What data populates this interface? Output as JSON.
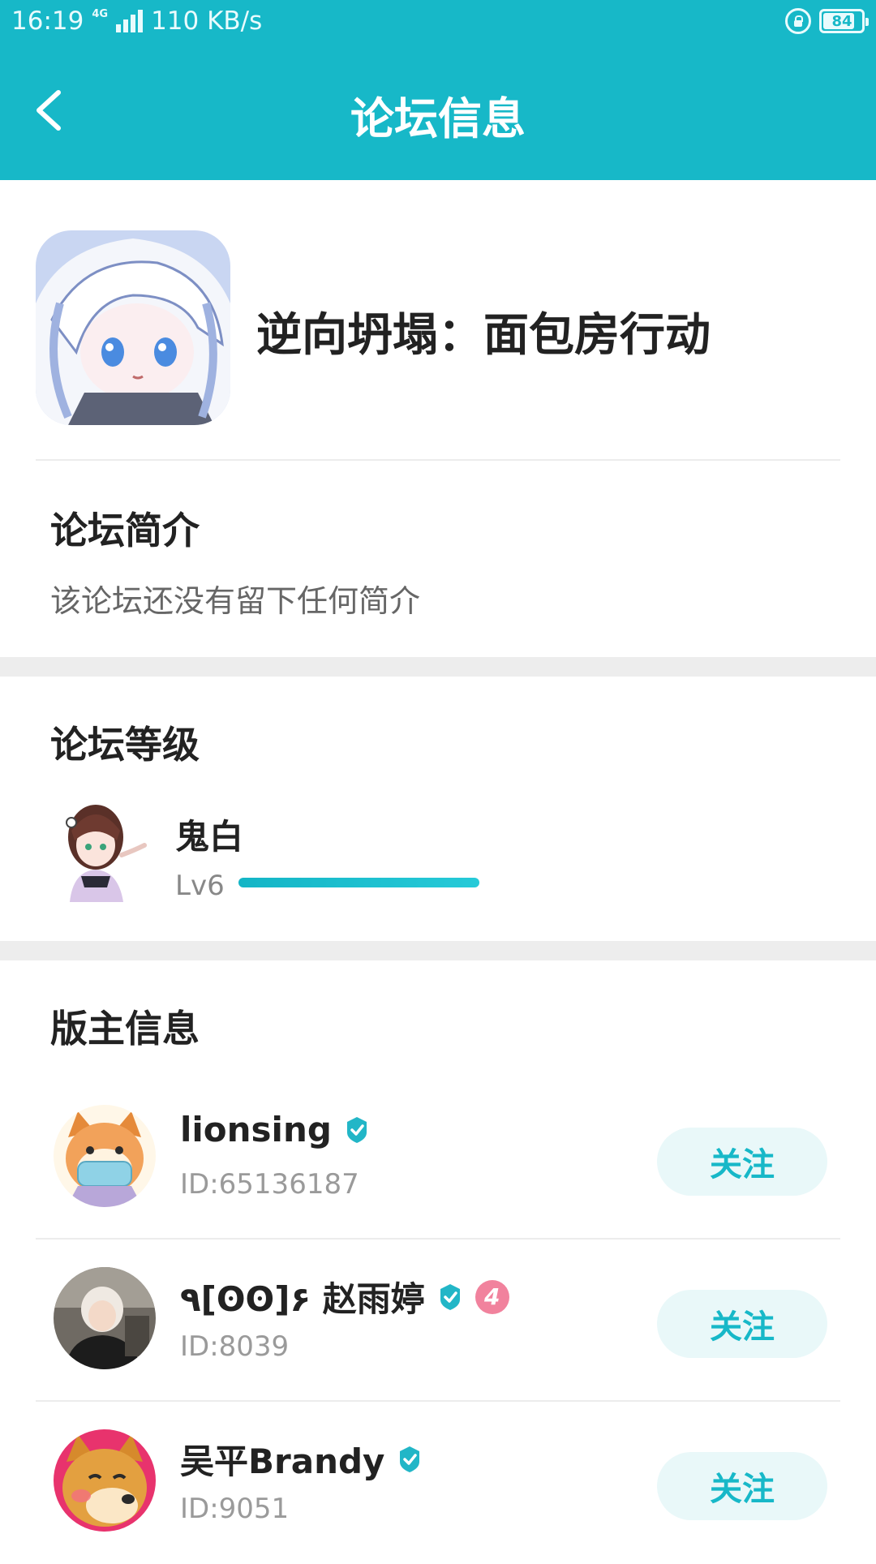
{
  "status_bar": {
    "time": "16:19",
    "network_type": "4G",
    "speed": "110 KB/s",
    "battery": "84",
    "battery_level": 0.84
  },
  "app_bar": {
    "title": "论坛信息",
    "back_icon": "chevron-left-icon"
  },
  "forum": {
    "name": "逆向坍塌：面包房行动"
  },
  "intro": {
    "title": "论坛简介",
    "text": "该论坛还没有留下任何简介"
  },
  "level": {
    "title": "论坛等级",
    "user_name": "鬼白",
    "level_label": "Lv6",
    "progress": 1.0
  },
  "moderators": {
    "title": "版主信息",
    "items": [
      {
        "name": "lionsing",
        "id_text": "ID:65136187",
        "verified": true,
        "level_badge": "",
        "follow_label": "关注"
      },
      {
        "name": "٩[ʘʘ]۶ 赵雨婷",
        "id_text": "ID:8039",
        "verified": true,
        "level_badge": "4",
        "follow_label": "关注"
      },
      {
        "name": "吴平Brandy",
        "id_text": "ID:9051",
        "verified": true,
        "level_badge": "",
        "follow_label": "关注"
      }
    ]
  },
  "colors": {
    "accent": "#17b8c8",
    "follow_bg": "#e9f8f9",
    "badge_pink": "#f1829d"
  }
}
